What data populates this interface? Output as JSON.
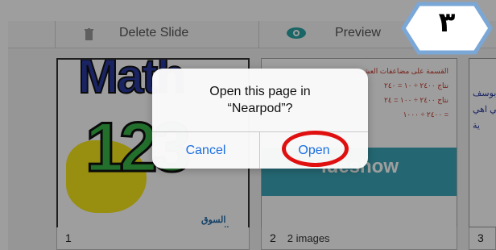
{
  "toolbar": {
    "delete_label": "Delete Slide",
    "preview_label": "Preview",
    "icons": [
      "trash-icon",
      "eye-icon"
    ]
  },
  "slides": [
    {
      "number": "1",
      "title_art": "Math",
      "digits_art": "123",
      "logo_text": "السوق المفتوح"
    },
    {
      "number": "2",
      "sub": "2 images",
      "band_text": "ideshow",
      "arabic_lines": [
        "القسمة على مضاعفات العشرة",
        "نتاج ٢٤٠٠ ÷ ١٠ = ٢٤٠",
        "نتاج ٢٤٠٠ ÷ ١٠٠ = ٢٤",
        "٢٤٠٠ ÷ ١٠٠٠ ="
      ]
    },
    {
      "number": "3",
      "peek_lines": [
        "بوسف",
        "لي اهي",
        "ية"
      ]
    }
  ],
  "alert": {
    "message_line1": "Open this page in",
    "message_line2": "“Nearpod”?",
    "cancel_label": "Cancel",
    "open_label": "Open"
  },
  "step_badge": {
    "text": "٣",
    "fill": "#ffffff",
    "border": "#7ba7d7"
  },
  "colors": {
    "accent": "#1a6ee0",
    "highlight": "#e01010",
    "eye": "#2aa3a3"
  }
}
